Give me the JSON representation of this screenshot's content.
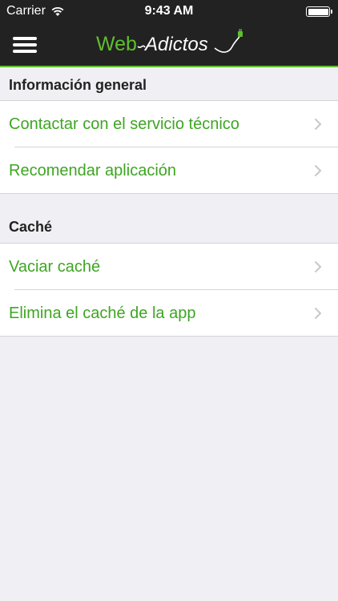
{
  "status_bar": {
    "carrier": "Carrier",
    "time": "9:43 AM"
  },
  "nav": {
    "logo_text": "WebAdictos",
    "menu_icon": "hamburger-menu-icon"
  },
  "colors": {
    "accent": "#3ea523",
    "nav_background": "#222222",
    "nav_underline": "#5fbf2f"
  },
  "sections": [
    {
      "title": "Información general",
      "items": [
        {
          "label": "Contactar con el servicio técnico"
        },
        {
          "label": "Recomendar aplicación"
        }
      ]
    },
    {
      "title": "Caché",
      "items": [
        {
          "label": "Vaciar caché"
        },
        {
          "label": "Elimina el caché de la app"
        }
      ]
    }
  ]
}
